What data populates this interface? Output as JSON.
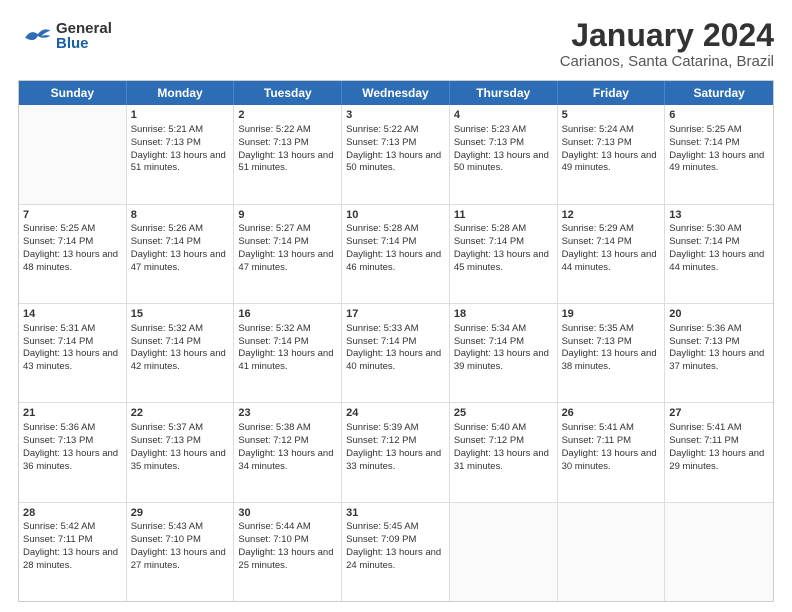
{
  "header": {
    "logo_general": "General",
    "logo_blue": "Blue",
    "title": "January 2024",
    "subtitle": "Carianos, Santa Catarina, Brazil"
  },
  "days": [
    "Sunday",
    "Monday",
    "Tuesday",
    "Wednesday",
    "Thursday",
    "Friday",
    "Saturday"
  ],
  "weeks": [
    [
      {
        "day": "",
        "sunrise": "",
        "sunset": "",
        "daylight": ""
      },
      {
        "day": "1",
        "sunrise": "Sunrise: 5:21 AM",
        "sunset": "Sunset: 7:13 PM",
        "daylight": "Daylight: 13 hours and 51 minutes."
      },
      {
        "day": "2",
        "sunrise": "Sunrise: 5:22 AM",
        "sunset": "Sunset: 7:13 PM",
        "daylight": "Daylight: 13 hours and 51 minutes."
      },
      {
        "day": "3",
        "sunrise": "Sunrise: 5:22 AM",
        "sunset": "Sunset: 7:13 PM",
        "daylight": "Daylight: 13 hours and 50 minutes."
      },
      {
        "day": "4",
        "sunrise": "Sunrise: 5:23 AM",
        "sunset": "Sunset: 7:13 PM",
        "daylight": "Daylight: 13 hours and 50 minutes."
      },
      {
        "day": "5",
        "sunrise": "Sunrise: 5:24 AM",
        "sunset": "Sunset: 7:13 PM",
        "daylight": "Daylight: 13 hours and 49 minutes."
      },
      {
        "day": "6",
        "sunrise": "Sunrise: 5:25 AM",
        "sunset": "Sunset: 7:14 PM",
        "daylight": "Daylight: 13 hours and 49 minutes."
      }
    ],
    [
      {
        "day": "7",
        "sunrise": "Sunrise: 5:25 AM",
        "sunset": "Sunset: 7:14 PM",
        "daylight": "Daylight: 13 hours and 48 minutes."
      },
      {
        "day": "8",
        "sunrise": "Sunrise: 5:26 AM",
        "sunset": "Sunset: 7:14 PM",
        "daylight": "Daylight: 13 hours and 47 minutes."
      },
      {
        "day": "9",
        "sunrise": "Sunrise: 5:27 AM",
        "sunset": "Sunset: 7:14 PM",
        "daylight": "Daylight: 13 hours and 47 minutes."
      },
      {
        "day": "10",
        "sunrise": "Sunrise: 5:28 AM",
        "sunset": "Sunset: 7:14 PM",
        "daylight": "Daylight: 13 hours and 46 minutes."
      },
      {
        "day": "11",
        "sunrise": "Sunrise: 5:28 AM",
        "sunset": "Sunset: 7:14 PM",
        "daylight": "Daylight: 13 hours and 45 minutes."
      },
      {
        "day": "12",
        "sunrise": "Sunrise: 5:29 AM",
        "sunset": "Sunset: 7:14 PM",
        "daylight": "Daylight: 13 hours and 44 minutes."
      },
      {
        "day": "13",
        "sunrise": "Sunrise: 5:30 AM",
        "sunset": "Sunset: 7:14 PM",
        "daylight": "Daylight: 13 hours and 44 minutes."
      }
    ],
    [
      {
        "day": "14",
        "sunrise": "Sunrise: 5:31 AM",
        "sunset": "Sunset: 7:14 PM",
        "daylight": "Daylight: 13 hours and 43 minutes."
      },
      {
        "day": "15",
        "sunrise": "Sunrise: 5:32 AM",
        "sunset": "Sunset: 7:14 PM",
        "daylight": "Daylight: 13 hours and 42 minutes."
      },
      {
        "day": "16",
        "sunrise": "Sunrise: 5:32 AM",
        "sunset": "Sunset: 7:14 PM",
        "daylight": "Daylight: 13 hours and 41 minutes."
      },
      {
        "day": "17",
        "sunrise": "Sunrise: 5:33 AM",
        "sunset": "Sunset: 7:14 PM",
        "daylight": "Daylight: 13 hours and 40 minutes."
      },
      {
        "day": "18",
        "sunrise": "Sunrise: 5:34 AM",
        "sunset": "Sunset: 7:14 PM",
        "daylight": "Daylight: 13 hours and 39 minutes."
      },
      {
        "day": "19",
        "sunrise": "Sunrise: 5:35 AM",
        "sunset": "Sunset: 7:13 PM",
        "daylight": "Daylight: 13 hours and 38 minutes."
      },
      {
        "day": "20",
        "sunrise": "Sunrise: 5:36 AM",
        "sunset": "Sunset: 7:13 PM",
        "daylight": "Daylight: 13 hours and 37 minutes."
      }
    ],
    [
      {
        "day": "21",
        "sunrise": "Sunrise: 5:36 AM",
        "sunset": "Sunset: 7:13 PM",
        "daylight": "Daylight: 13 hours and 36 minutes."
      },
      {
        "day": "22",
        "sunrise": "Sunrise: 5:37 AM",
        "sunset": "Sunset: 7:13 PM",
        "daylight": "Daylight: 13 hours and 35 minutes."
      },
      {
        "day": "23",
        "sunrise": "Sunrise: 5:38 AM",
        "sunset": "Sunset: 7:12 PM",
        "daylight": "Daylight: 13 hours and 34 minutes."
      },
      {
        "day": "24",
        "sunrise": "Sunrise: 5:39 AM",
        "sunset": "Sunset: 7:12 PM",
        "daylight": "Daylight: 13 hours and 33 minutes."
      },
      {
        "day": "25",
        "sunrise": "Sunrise: 5:40 AM",
        "sunset": "Sunset: 7:12 PM",
        "daylight": "Daylight: 13 hours and 31 minutes."
      },
      {
        "day": "26",
        "sunrise": "Sunrise: 5:41 AM",
        "sunset": "Sunset: 7:11 PM",
        "daylight": "Daylight: 13 hours and 30 minutes."
      },
      {
        "day": "27",
        "sunrise": "Sunrise: 5:41 AM",
        "sunset": "Sunset: 7:11 PM",
        "daylight": "Daylight: 13 hours and 29 minutes."
      }
    ],
    [
      {
        "day": "28",
        "sunrise": "Sunrise: 5:42 AM",
        "sunset": "Sunset: 7:11 PM",
        "daylight": "Daylight: 13 hours and 28 minutes."
      },
      {
        "day": "29",
        "sunrise": "Sunrise: 5:43 AM",
        "sunset": "Sunset: 7:10 PM",
        "daylight": "Daylight: 13 hours and 27 minutes."
      },
      {
        "day": "30",
        "sunrise": "Sunrise: 5:44 AM",
        "sunset": "Sunset: 7:10 PM",
        "daylight": "Daylight: 13 hours and 25 minutes."
      },
      {
        "day": "31",
        "sunrise": "Sunrise: 5:45 AM",
        "sunset": "Sunset: 7:09 PM",
        "daylight": "Daylight: 13 hours and 24 minutes."
      },
      {
        "day": "",
        "sunrise": "",
        "sunset": "",
        "daylight": ""
      },
      {
        "day": "",
        "sunrise": "",
        "sunset": "",
        "daylight": ""
      },
      {
        "day": "",
        "sunrise": "",
        "sunset": "",
        "daylight": ""
      }
    ]
  ]
}
